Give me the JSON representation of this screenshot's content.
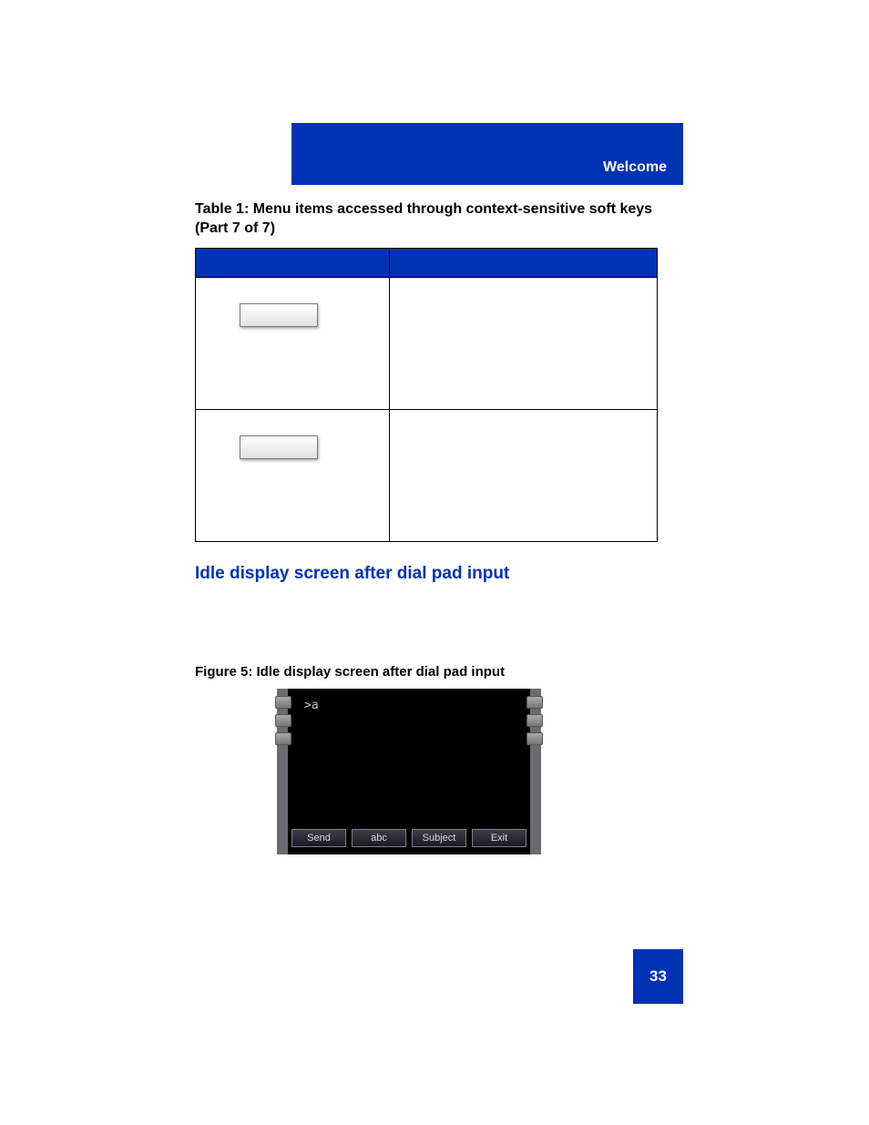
{
  "header": {
    "section": "Welcome"
  },
  "table": {
    "caption": "Table 1: Menu items accessed through context-sensitive soft keys (Part 7 of 7)"
  },
  "section_heading": "Idle display screen after dial pad input",
  "figure": {
    "caption": "Figure 5: Idle display screen after dial pad input",
    "prompt": ">a",
    "softkeys": [
      "Send",
      "abc",
      "Subject",
      "Exit"
    ]
  },
  "page_number": "33"
}
